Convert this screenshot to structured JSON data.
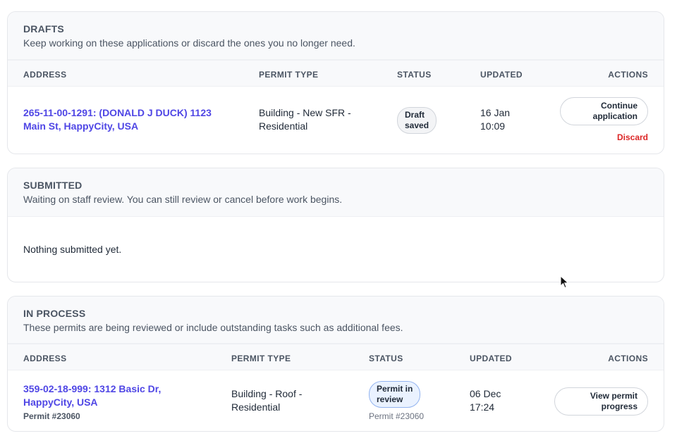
{
  "drafts": {
    "title": "DRAFTS",
    "description": "Keep working on these applications or discard the ones you no longer need.",
    "columns": {
      "address": "ADDRESS",
      "permit_type": "PERMIT TYPE",
      "status": "STATUS",
      "updated": "UPDATED",
      "actions": "ACTIONS"
    },
    "rows": [
      {
        "address_line1": "265-11-00-1291: (DONALD J DUCK) 1123",
        "address_line2": "Main St, HappyCity, USA",
        "permit_type_line1": "Building - New SFR -",
        "permit_type_line2": "Residential",
        "status_line1": "Draft",
        "status_line2": "saved",
        "updated_line1": "16 Jan",
        "updated_line2": "10:09",
        "action_line1": "Continue",
        "action_line2": "application",
        "discard": "Discard"
      }
    ]
  },
  "submitted": {
    "title": "SUBMITTED",
    "description": "Waiting on staff review. You can still review or cancel before work begins.",
    "empty": "Nothing submitted yet."
  },
  "in_process": {
    "title": "IN PROCESS",
    "description": "These permits are being reviewed or include outstanding tasks such as additional fees.",
    "columns": {
      "address": "ADDRESS",
      "permit_type": "PERMIT TYPE",
      "status": "STATUS",
      "updated": "UPDATED",
      "actions": "ACTIONS"
    },
    "rows": [
      {
        "address_line1": "359-02-18-999: 1312 Basic Dr,",
        "address_line2": "HappyCity, USA",
        "permit_number": "Permit #23060",
        "permit_type_line1": "Building - Roof -",
        "permit_type_line2": "Residential",
        "status_line1": "Permit in",
        "status_line2": "review",
        "status_note": "Permit #23060",
        "updated_line1": "06 Dec",
        "updated_line2": "17:24",
        "action_line1": "View permit",
        "action_line2": "progress"
      }
    ]
  },
  "colors": {
    "link": "#4f46e5",
    "danger": "#dc2626",
    "header_bg": "#f8f9fb",
    "review_badge_bg": "#eaf2ff"
  },
  "icons": {
    "cursor": "mouse-pointer-icon"
  }
}
